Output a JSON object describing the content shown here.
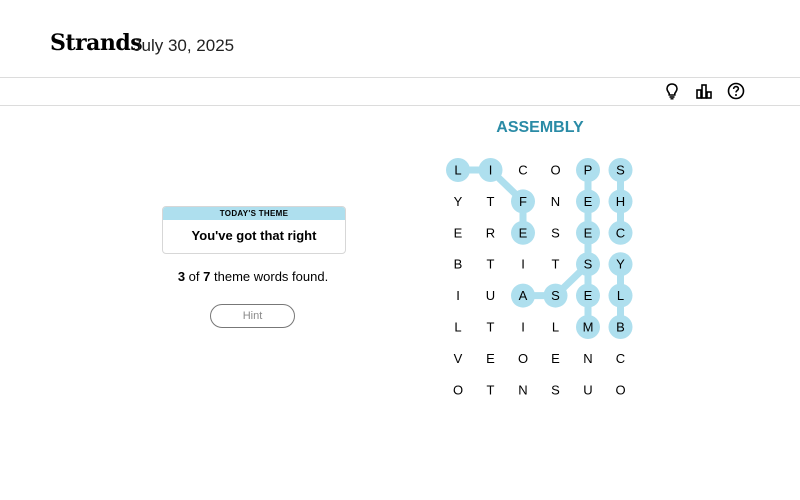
{
  "header": {
    "logo": "Strands",
    "date": "July 30, 2025"
  },
  "toolbar": {
    "icons": [
      "lightbulb-icon",
      "stats-icon",
      "help-icon"
    ]
  },
  "theme": {
    "heading": "TODAY'S THEME",
    "text": "You've got that right"
  },
  "progress": {
    "found": "3",
    "of": "of",
    "total": "7",
    "suffix": "theme words found."
  },
  "hint_label": "Hint",
  "spangram_found": "ASSEMBLY",
  "colors": {
    "highlight": "#aedfee",
    "accent": "#2a8ba6"
  },
  "grid": [
    [
      "L",
      "I",
      "C",
      "O",
      "P",
      "S"
    ],
    [
      "Y",
      "T",
      "F",
      "N",
      "E",
      "H"
    ],
    [
      "E",
      "R",
      "E",
      "S",
      "E",
      "C"
    ],
    [
      "B",
      "T",
      "I",
      "T",
      "S",
      "Y"
    ],
    [
      "I",
      "U",
      "A",
      "S",
      "E",
      "L"
    ],
    [
      "L",
      "T",
      "I",
      "L",
      "M",
      "B"
    ],
    [
      "V",
      "E",
      "O",
      "E",
      "N",
      "C"
    ],
    [
      "O",
      "T",
      "N",
      "S",
      "U",
      "O"
    ]
  ],
  "found_words": [
    {
      "cells": [
        [
          0,
          0
        ],
        [
          0,
          1
        ],
        [
          1,
          2
        ],
        [
          2,
          2
        ]
      ]
    },
    {
      "cells": [
        [
          0,
          4
        ],
        [
          1,
          4
        ],
        [
          2,
          4
        ],
        [
          3,
          4
        ],
        [
          4,
          4
        ],
        [
          5,
          4
        ]
      ]
    },
    {
      "cells": [
        [
          0,
          5
        ],
        [
          1,
          5
        ],
        [
          2,
          5
        ]
      ]
    },
    {
      "cells": [
        [
          4,
          2
        ],
        [
          4,
          3
        ],
        [
          3,
          4
        ]
      ]
    },
    {
      "cells": [
        [
          3,
          5
        ],
        [
          4,
          5
        ],
        [
          5,
          5
        ]
      ]
    }
  ]
}
